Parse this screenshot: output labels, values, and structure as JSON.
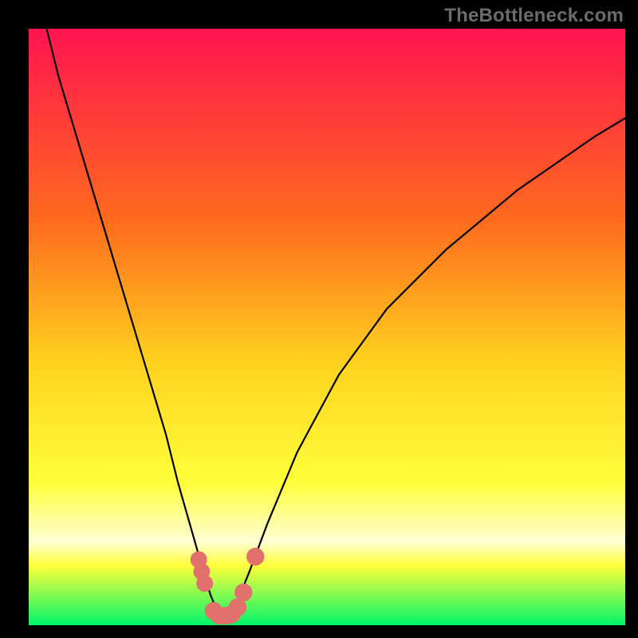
{
  "watermark": "TheBottleneck.com",
  "colors": {
    "background_black": "#000000",
    "gradient_top": "#ff1450",
    "gradient_mid1": "#ff6a1e",
    "gradient_mid2": "#ffd21e",
    "gradient_mid3": "#ffff3a",
    "gradient_low_pale": "#ffffd5",
    "gradient_bottom": "#00f56b",
    "curve": "#000000",
    "marker_fill": "#e2716e",
    "marker_stroke": "#b43e3b"
  },
  "chart_data": {
    "type": "line",
    "title": "",
    "xlabel": "",
    "ylabel": "",
    "xlim": [
      0,
      100
    ],
    "ylim": [
      0,
      100
    ],
    "series": [
      {
        "name": "bottleneck-curve",
        "x": [
          3,
          5,
          8,
          11,
          14,
          17,
          20,
          23,
          25,
          27,
          29,
          30.5,
          32,
          33.5,
          35,
          37,
          40,
          45,
          52,
          60,
          70,
          82,
          95,
          100
        ],
        "y": [
          100,
          92,
          82,
          72,
          62,
          52,
          42,
          32,
          24,
          17,
          10,
          5,
          1.5,
          1.5,
          4,
          9,
          17,
          29,
          42,
          53,
          63,
          73,
          82,
          85
        ]
      }
    ],
    "markers": [
      {
        "x": 28.5,
        "y": 11,
        "r": 1.4
      },
      {
        "x": 29.0,
        "y": 9,
        "r": 1.4
      },
      {
        "x": 29.5,
        "y": 7,
        "r": 1.4
      },
      {
        "x": 31.0,
        "y": 2.4,
        "r": 1.5
      },
      {
        "x": 32.0,
        "y": 1.6,
        "r": 1.5
      },
      {
        "x": 33.0,
        "y": 1.6,
        "r": 1.5
      },
      {
        "x": 34.0,
        "y": 1.8,
        "r": 1.5
      },
      {
        "x": 35.0,
        "y": 3.0,
        "r": 1.5
      },
      {
        "x": 36.0,
        "y": 5.5,
        "r": 1.5
      },
      {
        "x": 38.0,
        "y": 11.5,
        "r": 1.5
      }
    ]
  }
}
